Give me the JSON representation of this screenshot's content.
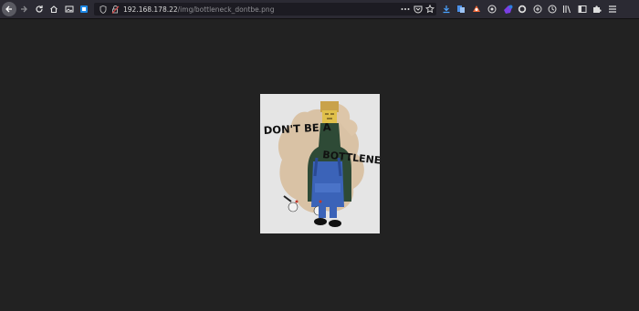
{
  "browser": {
    "url": {
      "host": "192.168.178.22",
      "path": "/img/bottleneck_dontbe.png"
    },
    "overflow_menu_icon": "ellipsis-icon",
    "toolbar_icons": [
      "download-icon",
      "extension-icon",
      "extension-icon",
      "extension-icon",
      "extension-icon",
      "extension-icon",
      "extension-icon",
      "history-icon",
      "library-icon",
      "sidebar-icon",
      "extensions-puzzle-icon",
      "hamburger-menu-icon"
    ]
  },
  "image": {
    "text_line1": "DON'T BE A",
    "text_line2": "BOTTLENECK",
    "background_color": "#e5e5e5",
    "page_background": "#222222"
  }
}
